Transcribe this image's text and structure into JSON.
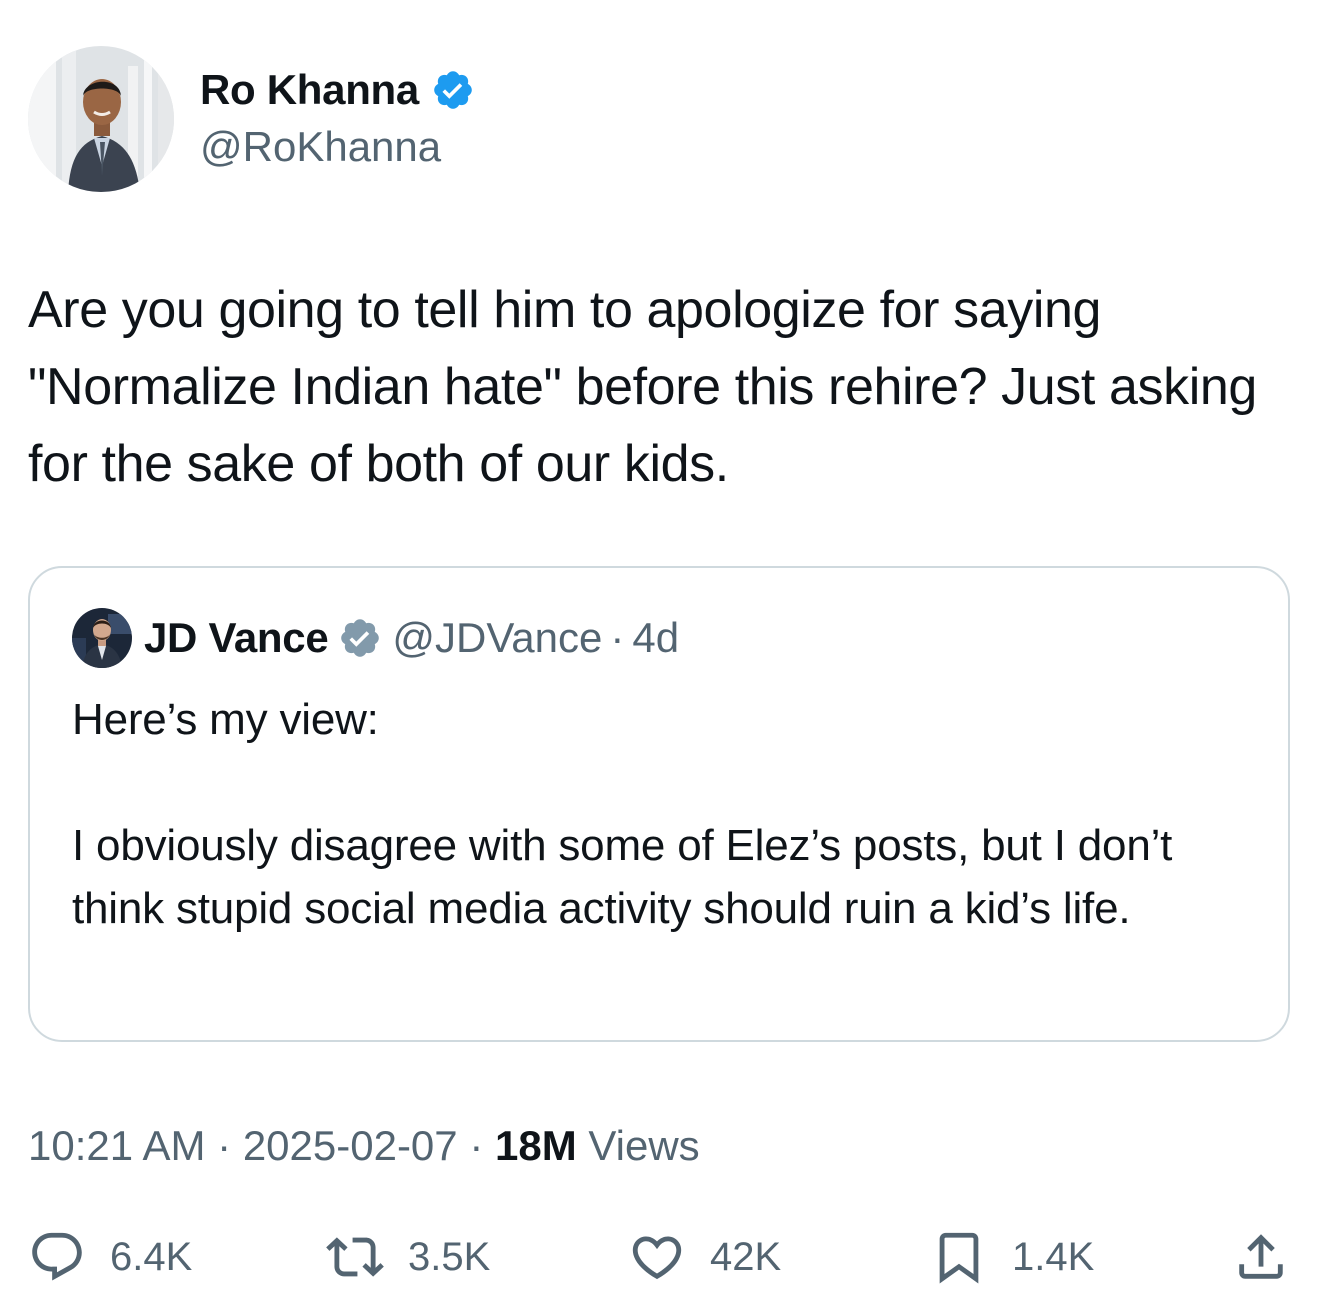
{
  "author": {
    "display_name": "Ro Khanna",
    "handle": "@RoKhanna",
    "verified": true
  },
  "tweet": {
    "text": "Are you going to tell him to apologize for saying \"Normalize Indian hate\" before this rehire? Just asking for the sake of both of our kids."
  },
  "quote": {
    "display_name": "JD Vance",
    "handle": "@JDVance",
    "separator": "·",
    "time": "4d",
    "text": "Here’s my view:\n\nI obviously disagree with some of Elez’s posts, but I don’t think stupid social media activity should ruin a kid’s life."
  },
  "meta": {
    "time": "10:21 AM",
    "separator": "·",
    "date": "2025-02-07",
    "views_count": "18M",
    "views_label": "Views"
  },
  "actions": {
    "replies": "6.4K",
    "reposts": "3.5K",
    "likes": "42K",
    "bookmarks": "1.4K"
  },
  "colors": {
    "text": "#0f1419",
    "secondary": "#536471",
    "verified": "#1d9bf0",
    "quote_verified": "#829aab",
    "border": "#cfd9de"
  },
  "icons": [
    "verified-badge-icon",
    "reply-icon",
    "repost-icon",
    "like-icon",
    "bookmark-icon",
    "share-icon"
  ]
}
